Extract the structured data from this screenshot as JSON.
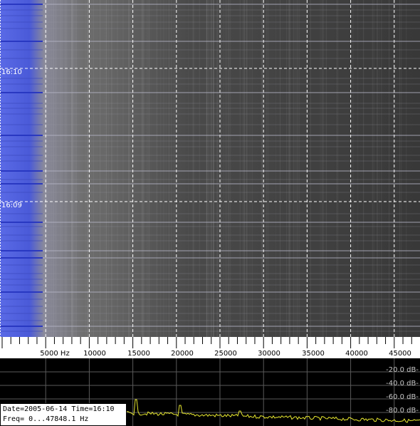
{
  "waterfall": {
    "time_labels": [
      "16:10",
      "16:09"
    ]
  },
  "frequency_axis": {
    "ticks": [
      {
        "value": 5000,
        "label": "5000 Hz"
      },
      {
        "value": 10000,
        "label": "10000"
      },
      {
        "value": 15000,
        "label": "15000"
      },
      {
        "value": 20000,
        "label": "20000"
      },
      {
        "value": 25000,
        "label": "25000"
      },
      {
        "value": 30000,
        "label": "30000"
      },
      {
        "value": 35000,
        "label": "35000"
      },
      {
        "value": 40000,
        "label": "40000"
      },
      {
        "value": 45000,
        "label": "45000"
      }
    ],
    "max_hz": 47848.1
  },
  "spectrum": {
    "db_labels": [
      "-20.0 dB-",
      "-40.0 dB-",
      "-60.0 dB-",
      "-80.0 dB-"
    ],
    "trace_color": "#e8e830"
  },
  "info": {
    "date_line": "Date=2005-06-14 Time=16:10",
    "freq_line": "Freq= 0...47848.1 Hz"
  },
  "colors": {
    "waterfall_bg": "#3a3a3a",
    "low_freq_blue": "#4a5ad8",
    "grid": "#ffffff"
  }
}
